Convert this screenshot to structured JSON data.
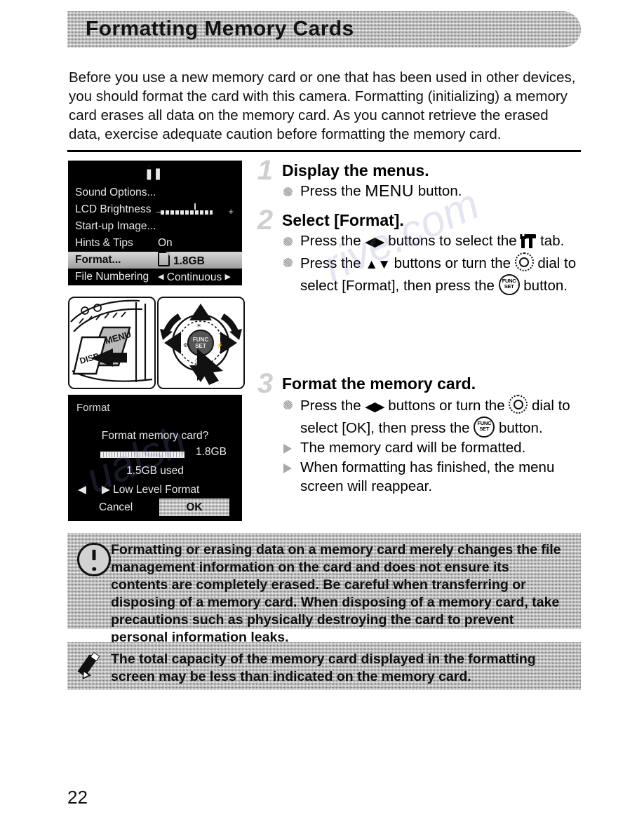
{
  "header": {
    "title": "Formatting Memory Cards"
  },
  "intro": {
    "text": "Before you use a new memory card or one that has been used in other devices, you should format the card with this camera. Formatting (initializing) a memory card erases all data on the memory card. As you cannot retrieve the erased data, exercise adequate caution before formatting the memory card."
  },
  "lcd_menu": {
    "tab_icon": "setup-tab-icon",
    "rows": [
      {
        "label": "Sound Options...",
        "value": "",
        "selected": false
      },
      {
        "label": "LCD Brightness",
        "value": "",
        "selected": false,
        "slider": {
          "minus": "–",
          "plus": "+"
        }
      },
      {
        "label": "Start-up Image...",
        "value": "",
        "selected": false
      },
      {
        "label": "Hints & Tips",
        "value": "On",
        "selected": false
      },
      {
        "label": "Format...",
        "value": "1.8GB",
        "selected": true
      },
      {
        "label": "File Numbering",
        "value": "Continuous",
        "selected": false,
        "arrows": true
      }
    ]
  },
  "illustrations": {
    "menu_button": "camera-menu-button-illustration",
    "control_dial": "camera-control-dial-illustration"
  },
  "lcd_format": {
    "title": "Format",
    "question": "Format memory card?",
    "total": "1.8GB",
    "used": "1.5GB used",
    "low_level_label": "Low Level Format",
    "cancel_label": "Cancel",
    "ok_label": "OK"
  },
  "steps": [
    {
      "number": "1",
      "heading": "Display the menus.",
      "lines": [
        {
          "bullet": "dot",
          "parts": [
            {
              "type": "text",
              "value": "Press the "
            },
            {
              "type": "icon",
              "value": "menu-text-icon",
              "label": "MENU"
            },
            {
              "type": "text",
              "value": " button."
            }
          ]
        }
      ]
    },
    {
      "number": "2",
      "heading": "Select [Format].",
      "lines": [
        {
          "bullet": "dot",
          "parts": [
            {
              "type": "text",
              "value": "Press the "
            },
            {
              "type": "icon",
              "value": "left-right-buttons-icon",
              "label": "◀▶"
            },
            {
              "type": "text",
              "value": " buttons to select the "
            },
            {
              "type": "icon",
              "value": "setup-tab-icon",
              "label": ""
            },
            {
              "type": "text",
              "value": " tab."
            }
          ]
        },
        {
          "bullet": "dot",
          "parts": [
            {
              "type": "text",
              "value": "Press the "
            },
            {
              "type": "icon",
              "value": "up-down-buttons-icon",
              "label": "▲▼"
            },
            {
              "type": "text",
              "value": " buttons or turn the "
            },
            {
              "type": "icon",
              "value": "control-dial-icon",
              "label": ""
            },
            {
              "type": "text",
              "value": " dial to select [Format], then press the "
            },
            {
              "type": "icon",
              "value": "func-set-button-icon",
              "label": "FUNC SET"
            },
            {
              "type": "text",
              "value": " button."
            }
          ]
        }
      ]
    },
    {
      "number": "3",
      "heading": "Format the memory card.",
      "lines": [
        {
          "bullet": "dot",
          "parts": [
            {
              "type": "text",
              "value": "Press the "
            },
            {
              "type": "icon",
              "value": "left-right-buttons-icon",
              "label": "◀▶"
            },
            {
              "type": "text",
              "value": " buttons or turn the "
            },
            {
              "type": "icon",
              "value": "control-dial-icon",
              "label": ""
            },
            {
              "type": "text",
              "value": " dial to select [OK], then press the "
            },
            {
              "type": "icon",
              "value": "func-set-button-icon",
              "label": "FUNC SET"
            },
            {
              "type": "text",
              "value": " button."
            }
          ]
        },
        {
          "bullet": "triangle",
          "parts": [
            {
              "type": "text",
              "value": "The memory card will be formatted."
            }
          ]
        },
        {
          "bullet": "triangle",
          "parts": [
            {
              "type": "text",
              "value": "When formatting has finished, the menu screen will reappear."
            }
          ]
        }
      ]
    }
  ],
  "callouts": {
    "caution": {
      "icon": "exclamation-icon",
      "text": "Formatting or erasing data on a memory card merely changes the file management information on the card and does not ensure its contents are completely erased. Be careful when transferring or disposing of a memory card. When disposing of a memory card, take precautions such as physically destroying the card to prevent personal information leaks."
    },
    "note": {
      "icon": "pencil-icon",
      "text": "The total capacity of the memory card displayed in the formatting screen may be less than indicated on the memory card."
    }
  },
  "page_number": "22",
  "func_set": {
    "line1": "FUNC",
    "line2": "SET"
  },
  "menu_word": "MENU"
}
